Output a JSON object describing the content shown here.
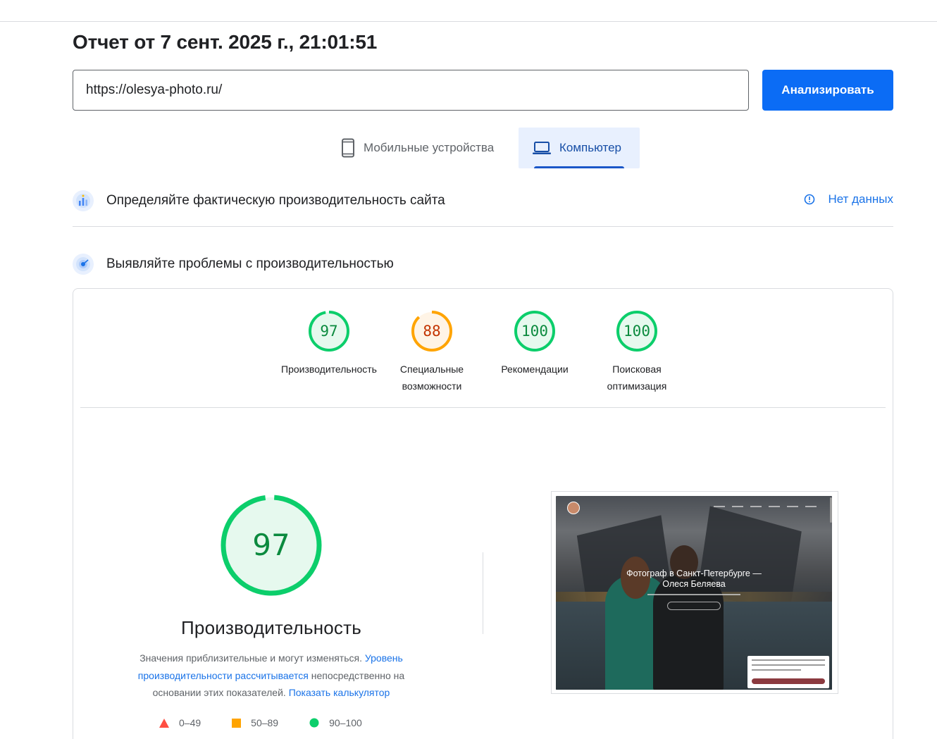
{
  "report": {
    "title": "Отчет от 7 сент. 2025 г., 21:01:51"
  },
  "search": {
    "url_value": "https://olesya-photo.ru/",
    "analyze_label": "Анализировать"
  },
  "tabs": [
    {
      "label": "Мобильные устройства",
      "icon": "smartphone-icon",
      "selected": false
    },
    {
      "label": "Компьютер",
      "icon": "laptop-icon",
      "selected": true
    }
  ],
  "field_section": {
    "title": "Определяйте фактическую производительность сайта",
    "icon": "field-data-icon",
    "status_label": "Нет данных",
    "status_icon": "info-icon"
  },
  "lab_section": {
    "title": "Выявляйте проблемы с производительностью",
    "icon": "lab-data-icon"
  },
  "scores": [
    {
      "value": "97",
      "label": "Производительность",
      "label_line2": "",
      "rating": "pass",
      "color": "#0cce6b"
    },
    {
      "value": "88",
      "label": "Специальные",
      "label_line2": "возможности",
      "rating": "average",
      "color": "#ffa400"
    },
    {
      "value": "100",
      "label": "Рекомендации",
      "label_line2": "",
      "rating": "pass",
      "color": "#0cce6b"
    },
    {
      "value": "100",
      "label": "Поисковая",
      "label_line2": "оптимизация",
      "rating": "pass",
      "color": "#0cce6b"
    }
  ],
  "performance": {
    "score": "97",
    "score_fraction": 0.97,
    "title": "Производительность",
    "desc_prefix": "Значения приблизительные и могут изменяться.",
    "desc_link1": "Уровень производительности рассчитывается",
    "desc_middle": "непосредственно на основании этих показателей.",
    "desc_link2": "Показать калькулятор"
  },
  "legend": [
    {
      "range": "0–49",
      "shape": "triangle",
      "color": "#ff4e42"
    },
    {
      "range": "50–89",
      "shape": "square",
      "color": "#ffa400"
    },
    {
      "range": "90–100",
      "shape": "circle",
      "color": "#0cce6b"
    }
  ],
  "screenshot": {
    "hero_title": "Фотограф в Санкт-Петербурге —",
    "hero_name": "Олеся Беляева"
  },
  "colors": {
    "accent": "#1a73e8",
    "pass": "#0cce6b",
    "average": "#ffa400",
    "fail": "#ff4e42",
    "pass_text": "#0b8a3e",
    "average_text": "#c33300"
  }
}
